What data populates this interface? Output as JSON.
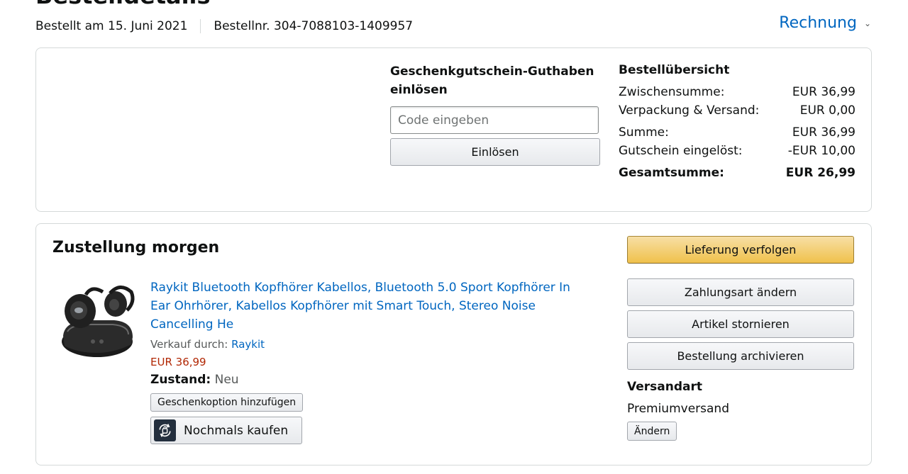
{
  "header": {
    "title": "Bestelldetails",
    "order_date": "Bestellt am 15. Juni 2021",
    "order_number": "Bestellnr. 304-7088103-1409957",
    "invoice_label": "Rechnung"
  },
  "gift_card": {
    "heading": "Geschenkgutschein-Guthaben einlösen",
    "code_placeholder": "Code eingeben",
    "redeem_label": "Einlösen"
  },
  "order_summary": {
    "heading": "Bestellübersicht",
    "rows": [
      {
        "label": "Zwischensumme:",
        "value": "EUR 36,99"
      },
      {
        "label": "Verpackung & Versand:",
        "value": "EUR 0,00"
      },
      {
        "label": "Summe:",
        "value": "EUR 36,99"
      },
      {
        "label": "Gutschein eingelöst:",
        "value": "-EUR 10,00"
      }
    ],
    "total_label": "Gesamtsumme:",
    "total_value": "EUR 26,99"
  },
  "shipment": {
    "status": "Zustellung morgen",
    "product": {
      "image_icon": "earbuds-product-image",
      "title": "Raykit Bluetooth Kopfhörer Kabellos, Bluetooth 5.0 Sport Kopfhörer In Ear Ohrhörer, Kabellos Kopfhörer mit Smart Touch, Stereo Noise Cancelling He",
      "sold_by_label": "Verkauf durch:",
      "seller": "Raykit",
      "price": "EUR 36,99",
      "condition_label": "Zustand:",
      "condition_value": "Neu",
      "gift_option_label": "Geschenkoption hinzufügen",
      "buy_again_label": "Nochmals kaufen"
    },
    "actions": {
      "track": "Lieferung verfolgen",
      "change_payment": "Zahlungsart ändern",
      "cancel_items": "Artikel stornieren",
      "archive_order": "Bestellung archivieren"
    },
    "shipping_method": {
      "heading": "Versandart",
      "value": "Premiumversand",
      "change_label": "Ändern"
    }
  },
  "colors": {
    "link": "#0066c0",
    "price": "#b12704",
    "primary_button": "#f0c14b",
    "border": "#d5d9d9"
  }
}
